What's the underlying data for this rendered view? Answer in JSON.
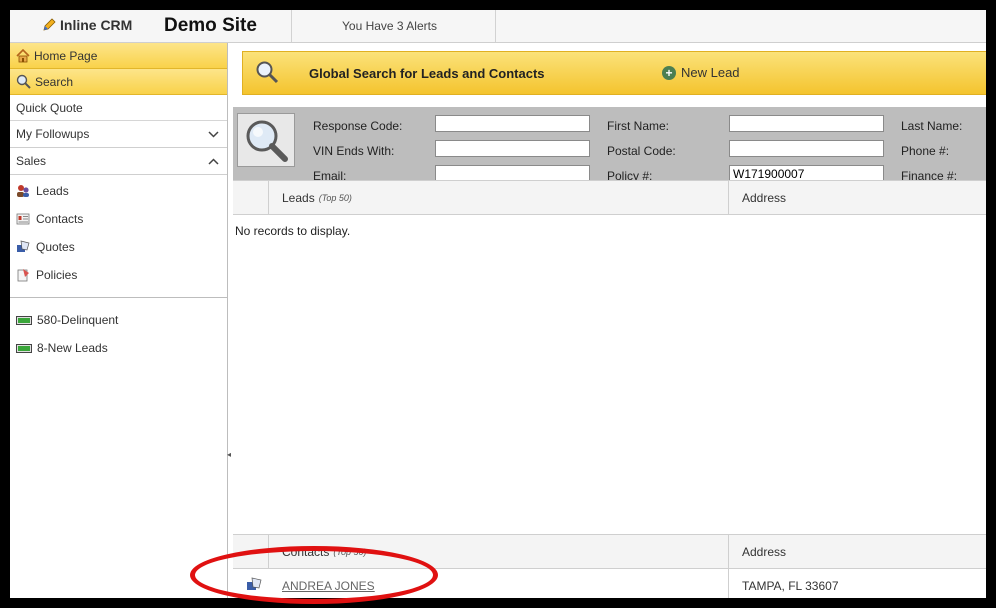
{
  "app": {
    "logo_text": "Inline CRM",
    "site_title": "Demo Site",
    "alerts": "You Have 3 Alerts"
  },
  "sidebar": {
    "nav": [
      {
        "label": "Home Page",
        "icon": "home-icon",
        "active": true
      },
      {
        "label": "Search",
        "icon": "search-icon",
        "active": true
      },
      {
        "label": "Quick Quote"
      }
    ],
    "followups": {
      "label": "My Followups",
      "state": "collapsed"
    },
    "sales": {
      "label": "Sales",
      "state": "expanded",
      "items": [
        {
          "label": "Leads",
          "icon": "leads-icon"
        },
        {
          "label": "Contacts",
          "icon": "contacts-icon"
        },
        {
          "label": "Quotes",
          "icon": "quotes-icon"
        },
        {
          "label": "Policies",
          "icon": "policies-icon"
        }
      ]
    },
    "queues": [
      {
        "label": "580-Delinquent",
        "icon": "queue-icon"
      },
      {
        "label": "8-New Leads",
        "icon": "queue-icon"
      }
    ]
  },
  "search": {
    "title": "Global Search for Leads and Contacts",
    "new_lead": "New Lead",
    "fields": {
      "response_code": {
        "label": "Response Code:",
        "value": ""
      },
      "first_name": {
        "label": "First Name:",
        "value": ""
      },
      "last_name": {
        "label": "Last Name:"
      },
      "vin": {
        "label": "VIN Ends With:",
        "value": ""
      },
      "postal_code": {
        "label": "Postal Code:",
        "value": ""
      },
      "phone": {
        "label": "Phone #:"
      },
      "email": {
        "label": "Email:",
        "value": ""
      },
      "policy": {
        "label": "Policy #:",
        "value": "W171900007"
      },
      "finance": {
        "label": "Finance #:"
      }
    }
  },
  "leads_grid": {
    "col_name": "Leads",
    "col_note": "(Top 50)",
    "col_address": "Address",
    "empty_text": "No records to display."
  },
  "contacts_grid": {
    "col_name": "Contacts",
    "col_note": "(Top 50)",
    "col_address": "Address",
    "rows": [
      {
        "name": "ANDREA JONES",
        "address": "TAMPA, FL 33607"
      }
    ]
  },
  "colors": {
    "accent_yellow": "#f9d24a",
    "highlight_red": "#e01111",
    "plus_green": "#4b7f52"
  }
}
